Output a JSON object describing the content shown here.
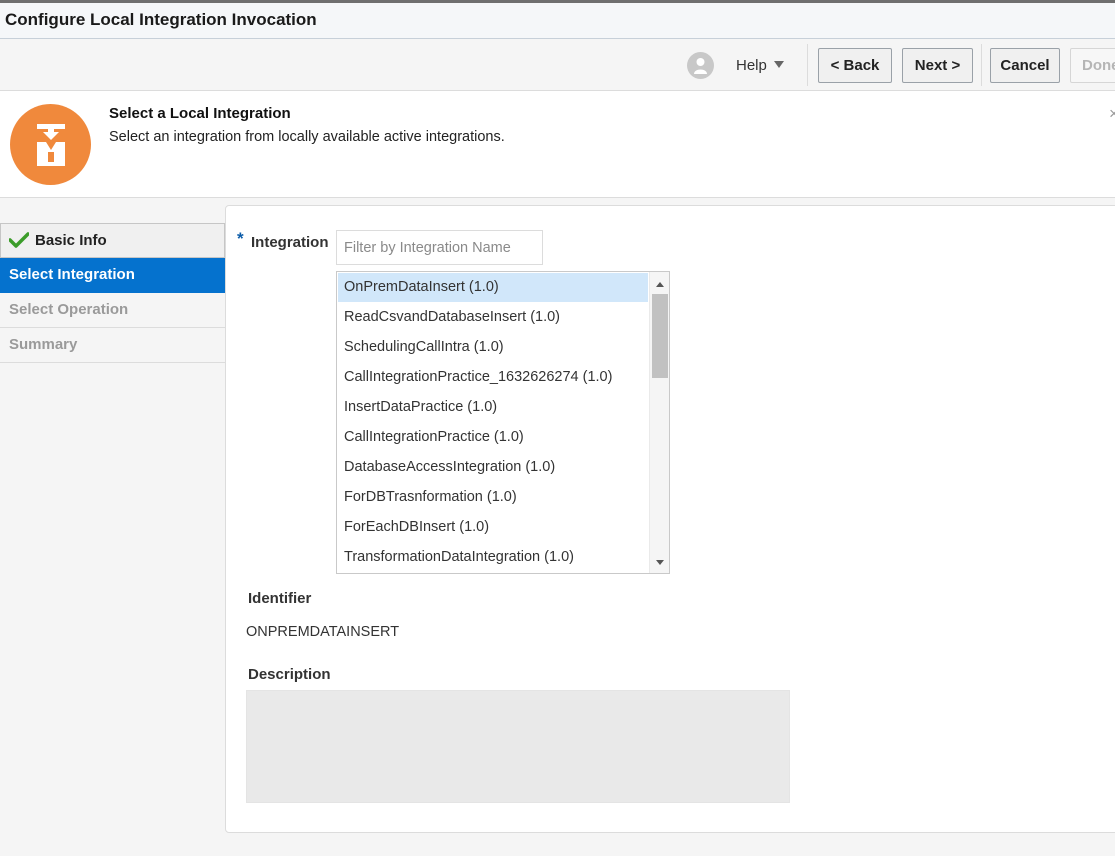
{
  "window": {
    "title": "Configure Local Integration Invocation"
  },
  "toolbar": {
    "help_label": "Help",
    "back_label": "< Back",
    "next_label": "Next >",
    "cancel_label": "Cancel",
    "done_label": "Done"
  },
  "header": {
    "title": "Select a Local Integration",
    "subtitle": "Select an integration from locally available active integrations.",
    "icon": "integration-badge-icon",
    "close_glyph": "×"
  },
  "train": {
    "items": [
      {
        "label": "Basic Info",
        "state": "visited"
      },
      {
        "label": "Select Integration",
        "state": "active"
      },
      {
        "label": "Select Operation",
        "state": "disabled"
      },
      {
        "label": "Summary",
        "state": "disabled"
      }
    ]
  },
  "form": {
    "required_marker": "*",
    "integration_label": "Integration",
    "filter_placeholder": "Filter by Integration Name",
    "filter_value": "",
    "integrations": [
      "OnPremDataInsert (1.0)",
      "ReadCsvandDatabaseInsert (1.0)",
      "SchedulingCallIntra (1.0)",
      "CallIntegrationPractice_1632626274 (1.0)",
      "InsertDataPractice (1.0)",
      "CallIntegrationPractice (1.0)",
      "DatabaseAccessIntegration (1.0)",
      "ForDBTrasnformation (1.0)",
      "ForEachDBInsert (1.0)",
      "TransformationDataIntegration (1.0)"
    ],
    "selected_integration": "OnPremDataInsert (1.0)",
    "identifier_label": "Identifier",
    "identifier_value": "ONPREMDATAINSERT",
    "description_label": "Description",
    "description_value": ""
  },
  "colors": {
    "accent": "#0572ce",
    "badge": "#f0893c",
    "selected_row": "#d1e7fa",
    "check": "#3b9c2a"
  }
}
